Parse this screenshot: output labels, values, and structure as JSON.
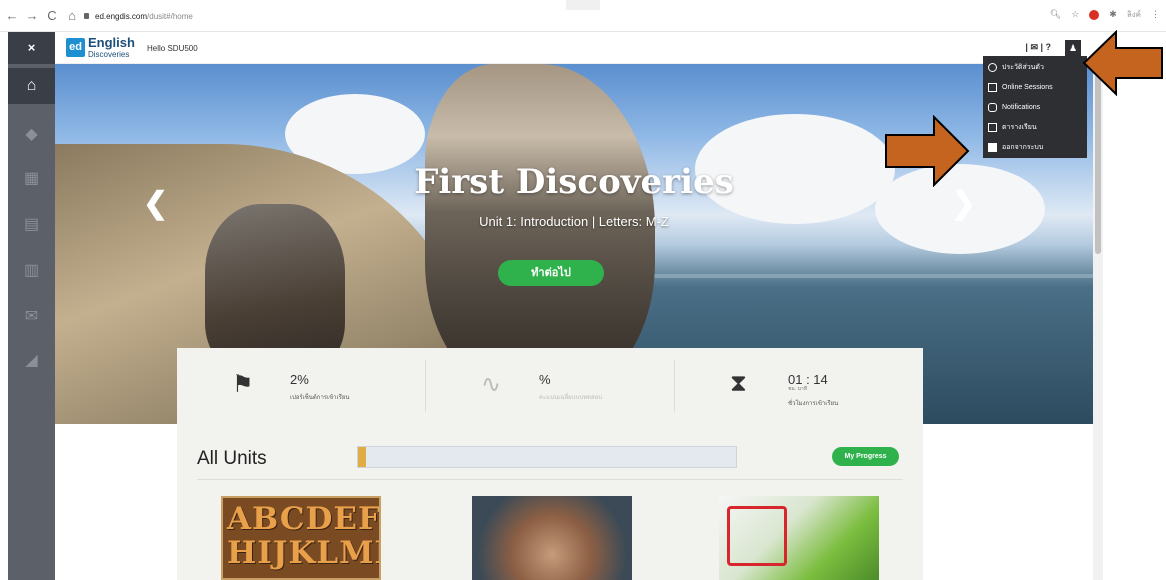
{
  "browser": {
    "back": "←",
    "forward": "→",
    "reload": "C",
    "home": "⌂",
    "url_host": "ed.engdis.com",
    "url_path": "/dusit#/home",
    "right_icons": [
      "search-icon",
      "star-icon",
      "extension-icon",
      "puzzle-icon"
    ],
    "profile_label": "ลิงค์",
    "menu": "⋮"
  },
  "sidebar": {
    "close_label": "×",
    "items": [
      {
        "icon": "home-icon",
        "glyph": "⌂"
      },
      {
        "icon": "graduation-cap-icon",
        "glyph": "◆"
      },
      {
        "icon": "community-icon",
        "glyph": "▦"
      },
      {
        "icon": "clipboard-icon",
        "glyph": "▤"
      },
      {
        "icon": "gradebook-icon",
        "glyph": "▥"
      },
      {
        "icon": "mail-icon",
        "glyph": "✉"
      },
      {
        "icon": "book-icon",
        "glyph": "◢"
      }
    ]
  },
  "header": {
    "logo_mark": "ed",
    "logo_title": "English",
    "logo_sub": "Discoveries",
    "greeting": "Hello SDU500",
    "icons_text": "| ✉ | ?",
    "user_icon": "♟"
  },
  "hero": {
    "title": "First Discoveries",
    "subtitle": "Unit 1: Introduction | Letters: M-Z",
    "continue_label": "ทำต่อไป",
    "prev": "❮",
    "next": "❯"
  },
  "stats": [
    {
      "icon": "flag-icon",
      "glyph": "⚑",
      "value": "2%",
      "label": "เปอร์เซ็นต์การเข้าเรียน",
      "faded": false
    },
    {
      "icon": "pulse-icon",
      "glyph": "∿",
      "value": "%",
      "label": "คะแนนเฉลี่ยแบบทดสอบ",
      "faded": true
    },
    {
      "icon": "hourglass-icon",
      "glyph": "⧗",
      "value": "01 : 14",
      "units": "ชม.    นาที",
      "label": "ชั่วโมงการเข้าเรียน",
      "faded": false
    }
  ],
  "units": {
    "title": "All Units",
    "progress": 0.02,
    "my_progress_label": "My Progress",
    "thumb_abc_text": "ABCDEFG\nHIJKLMN"
  },
  "user_menu": [
    {
      "icon": "profile-icon",
      "label": "ประวัติส่วนตัว"
    },
    {
      "icon": "online-sessions-icon",
      "label": "Online Sessions"
    },
    {
      "icon": "notifications-icon",
      "label": "Notifications"
    },
    {
      "icon": "calendar-icon",
      "label": "ตารางเรียน"
    },
    {
      "icon": "logout-icon",
      "label": "ออกจากระบบ"
    }
  ],
  "colors": {
    "accent_green": "#2fb24c",
    "sidebar": "#5c6069",
    "menu_bg": "#2d2f33",
    "annotation_arrow": "#c5641e",
    "progress_fill": "#e0ac44"
  }
}
